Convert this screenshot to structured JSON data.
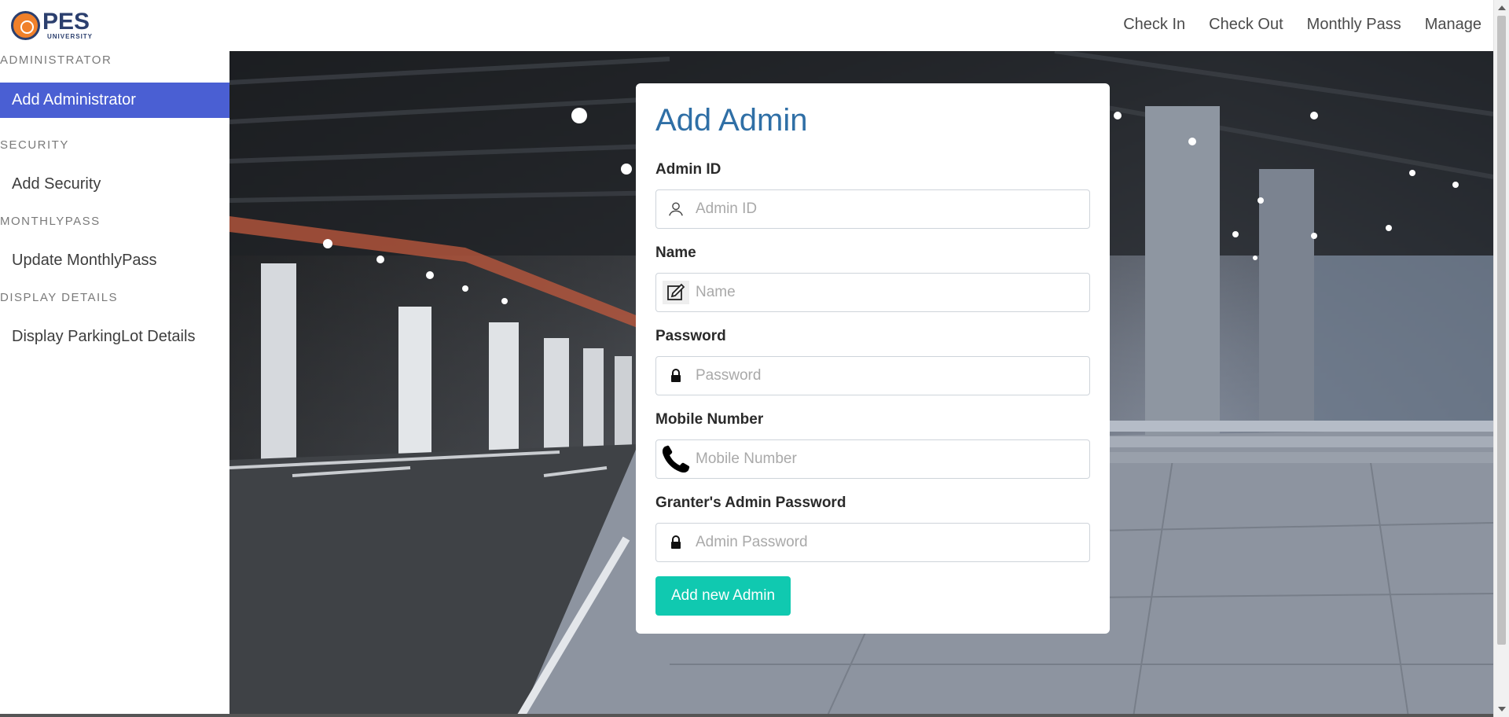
{
  "brand": {
    "logo_text": "PES",
    "logo_subtext": "UNIVERSITY"
  },
  "nav": {
    "links": [
      "Check In",
      "Check Out",
      "Monthly Pass",
      "Manage"
    ]
  },
  "sidebar": {
    "sections": [
      {
        "heading": "ADMINISTRATOR",
        "item": "Add Administrator",
        "active": true
      },
      {
        "heading": "SECURITY",
        "item": "Add Security",
        "active": false
      },
      {
        "heading": "MONTHLYPASS",
        "item": "Update MonthlyPass",
        "active": false
      },
      {
        "heading": "DISPLAY DETAILS",
        "item": "Display ParkingLot Details",
        "active": false
      }
    ]
  },
  "form": {
    "title": "Add Admin",
    "fields": [
      {
        "label": "Admin ID",
        "placeholder": "Admin ID",
        "value": "",
        "icon": "user-icon",
        "type": "text"
      },
      {
        "label": "Name",
        "placeholder": "Name",
        "value": "",
        "icon": "edit-icon",
        "type": "text"
      },
      {
        "label": "Password",
        "placeholder": "Password",
        "value": "",
        "icon": "lock-icon",
        "type": "password"
      },
      {
        "label": "Mobile Number",
        "placeholder": "Mobile Number",
        "value": "",
        "icon": "phone-icon",
        "type": "text"
      },
      {
        "label": "Granter's Admin Password",
        "placeholder": "Admin Password",
        "value": "",
        "icon": "lock-icon",
        "type": "password"
      }
    ],
    "submit_label": "Add new Admin"
  },
  "colors": {
    "accent": "#4a5fd3",
    "title": "#2f6fa6",
    "button": "#10c9b0",
    "brand": "#2b3f6e"
  }
}
